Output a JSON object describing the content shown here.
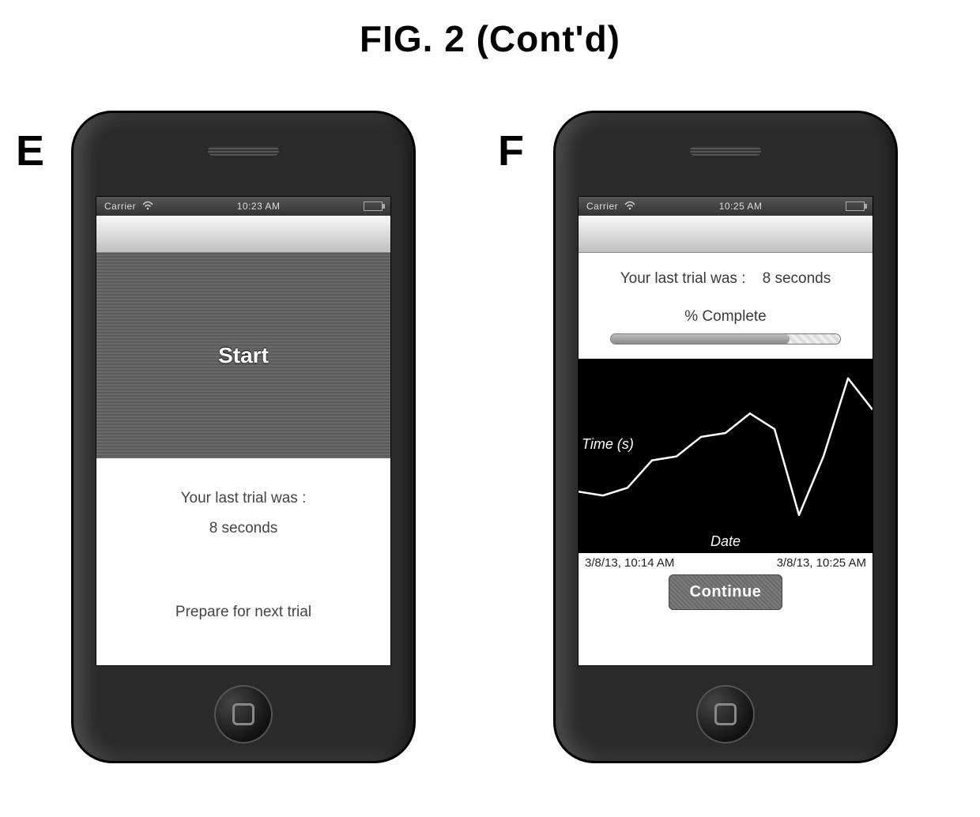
{
  "title": "FIG. 2 (Cont'd)",
  "panels": {
    "E": "E",
    "F": "F"
  },
  "statusbar": {
    "carrier": "Carrier",
    "time_e": "10:23 AM",
    "time_f": "10:25 AM"
  },
  "screenE": {
    "start_label": "Start",
    "last_trial_label": "Your last trial was :",
    "last_trial_value": "8 seconds",
    "prepare_label": "Prepare for next trial"
  },
  "screenF": {
    "last_trial_label": "Your last trial was :",
    "last_trial_value": "8 seconds",
    "complete_label": "% Complete",
    "dates": {
      "start": "3/8/13, 10:14 AM",
      "end": "3/8/13, 10:25 AM"
    },
    "continue_label": "Continue"
  },
  "chart_data": {
    "type": "line",
    "title": "",
    "xlabel": "Date",
    "ylabel": "Time (s)",
    "x": [
      0,
      1,
      2,
      3,
      4,
      5,
      6,
      7,
      8,
      9,
      10,
      11,
      12
    ],
    "values": [
      3.2,
      3.0,
      3.4,
      4.8,
      5.0,
      6.0,
      6.2,
      7.2,
      6.4,
      2.0,
      5.0,
      9.0,
      7.4
    ],
    "ylim": [
      0,
      10
    ]
  }
}
